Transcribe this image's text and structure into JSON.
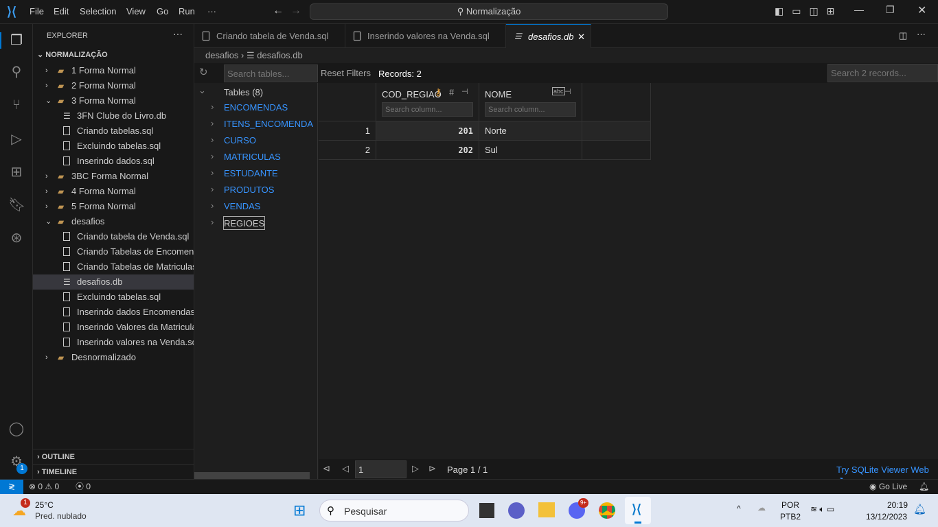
{
  "menu": [
    "File",
    "Edit",
    "Selection",
    "View",
    "Go",
    "Run",
    "···"
  ],
  "command_center": "Normalização",
  "explorer": {
    "title": "EXPLORER",
    "root": "NORMALIZAÇÃO",
    "items": [
      {
        "label": "1 Forma Normal",
        "type": "folder",
        "open": false,
        "depth": 0
      },
      {
        "label": "2 Forma Normal",
        "type": "folder",
        "open": false,
        "depth": 0
      },
      {
        "label": "3 Forma Normal",
        "type": "folder",
        "open": true,
        "depth": 0
      },
      {
        "label": "3FN Clube do Livro.db",
        "type": "db",
        "depth": 1
      },
      {
        "label": "Criando tabelas.sql",
        "type": "file",
        "depth": 1
      },
      {
        "label": "Excluindo tabelas.sql",
        "type": "file",
        "depth": 1
      },
      {
        "label": "Inserindo dados.sql",
        "type": "file",
        "depth": 1
      },
      {
        "label": "3BC Forma Normal",
        "type": "folder",
        "open": false,
        "depth": 0
      },
      {
        "label": "4 Forma Normal",
        "type": "folder",
        "open": false,
        "depth": 0
      },
      {
        "label": "5 Forma Normal",
        "type": "folder",
        "open": false,
        "depth": 0
      },
      {
        "label": "desafios",
        "type": "folder",
        "open": true,
        "depth": 0
      },
      {
        "label": "Criando tabela de Venda.sql",
        "type": "file",
        "depth": 1
      },
      {
        "label": "Criando Tabelas de Encomendas.sql",
        "type": "file",
        "depth": 1
      },
      {
        "label": "Criando Tabelas de Matriculas.sql",
        "type": "file",
        "depth": 1
      },
      {
        "label": "desafios.db",
        "type": "db",
        "depth": 1,
        "selected": true
      },
      {
        "label": "Excluindo tabelas.sql",
        "type": "file",
        "depth": 1
      },
      {
        "label": "Inserindo dados Encomendas.sql",
        "type": "file",
        "depth": 1
      },
      {
        "label": "Inserindo Valores da Matriculas.sql",
        "type": "file",
        "depth": 1
      },
      {
        "label": "Inserindo valores na Venda.sql",
        "type": "file",
        "depth": 1
      },
      {
        "label": "Desnormalizado",
        "type": "folder",
        "open": false,
        "depth": 0
      }
    ],
    "outline": "OUTLINE",
    "timeline": "TIMELINE"
  },
  "tabs": [
    {
      "label": "Criando tabela de Venda.sql"
    },
    {
      "label": "Inserindo valores na Venda.sql"
    },
    {
      "label": "desafios.db",
      "active": true
    }
  ],
  "breadcrumb": [
    "desafios",
    "desafios.db"
  ],
  "viewer": {
    "search_tables_placeholder": "Search tables...",
    "reset_filters": "Reset Filters",
    "records": "Records: 2",
    "search_records_placeholder": "Search 2 records...",
    "tables_header": "Tables (8)",
    "tables": [
      "ENCOMENDAS",
      "ITENS_ENCOMENDA",
      "CURSO",
      "MATRICULAS",
      "ESTUDANTE",
      "PRODUTOS",
      "VENDAS",
      "REGIOES"
    ],
    "columns": [
      {
        "name": "COD_REGIAO",
        "primary_key": true,
        "type": "number"
      },
      {
        "name": "NOME",
        "type": "text"
      }
    ],
    "search_column_placeholder": "Search column...",
    "rows": [
      {
        "n": "1",
        "cells": [
          "201",
          "Norte"
        ]
      },
      {
        "n": "2",
        "cells": [
          "202",
          "Sul"
        ]
      }
    ],
    "page_input": "1",
    "page_label": "Page 1 / 1",
    "try_link": "Try SQLite Viewer Web ↗"
  },
  "status": {
    "errors": "0",
    "warnings": "0",
    "ports": "0",
    "go_live": "Go Live"
  },
  "taskbar": {
    "weather_temp": "25°C",
    "weather_desc": "Pred. nublado",
    "weather_badge": "1",
    "search": "Pesquisar",
    "discord_badge": "9+",
    "lang1": "POR",
    "lang2": "PTB2",
    "time": "20:19",
    "date": "13/12/2023"
  },
  "colors": {
    "accent": "#0078d4",
    "link": "#3794ff",
    "key": "#e8a33d"
  }
}
